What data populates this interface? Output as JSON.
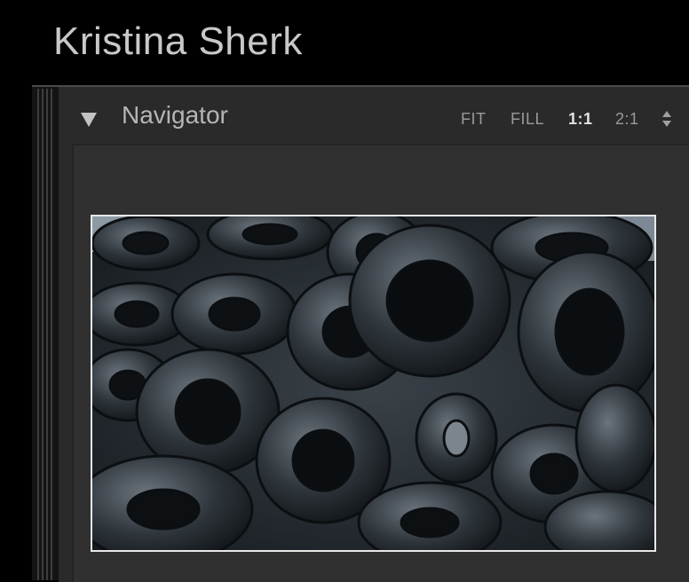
{
  "identity_plate": {
    "name": "Kristina Sherk"
  },
  "navigator": {
    "title": "Navigator",
    "disclosure_icon": "triangle-down-icon",
    "zoom_options": [
      {
        "label": "FIT",
        "active": false
      },
      {
        "label": "FILL",
        "active": false
      },
      {
        "label": "1:1",
        "active": true
      },
      {
        "label": "2:1",
        "active": false
      }
    ],
    "stepper_icon": "up-down-arrows-icon"
  },
  "preview": {
    "subject": "pile-of-old-tires-photo"
  },
  "colors": {
    "background": "#000000",
    "panel": "#2a2a2a",
    "preview_bg": "#303030",
    "frame_border": "#e8e8e8",
    "text_primary": "#c8c8c8",
    "text_muted": "#9a9a9a"
  }
}
